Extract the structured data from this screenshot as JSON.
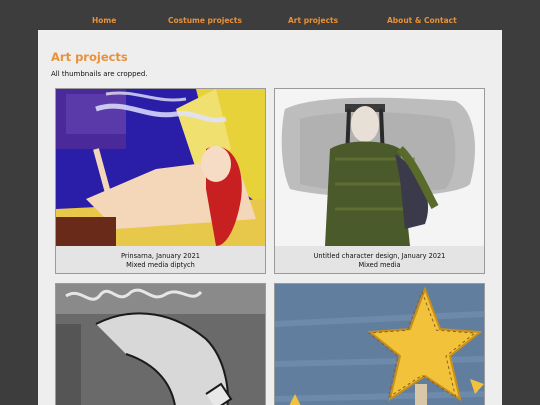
{
  "nav": {
    "items": [
      {
        "label": "Home"
      },
      {
        "label": "Costume projects"
      },
      {
        "label": "Art projects"
      },
      {
        "label": "About & Contact"
      }
    ]
  },
  "page": {
    "title": "Art projects",
    "note": "All thumbnails are cropped."
  },
  "gallery": [
    {
      "caption_line1": "Prinsarna, January 2021",
      "caption_line2": "Mixed media diptych"
    },
    {
      "caption_line1": "Untitled character design, January 2021",
      "caption_line2": "Mixed media"
    },
    {
      "caption_line1": "",
      "caption_line2": ""
    },
    {
      "caption_line1": "",
      "caption_line2": ""
    }
  ],
  "colors": {
    "background": "#3d3d3d",
    "panel": "#eeeeee",
    "accent": "#e8913a"
  }
}
